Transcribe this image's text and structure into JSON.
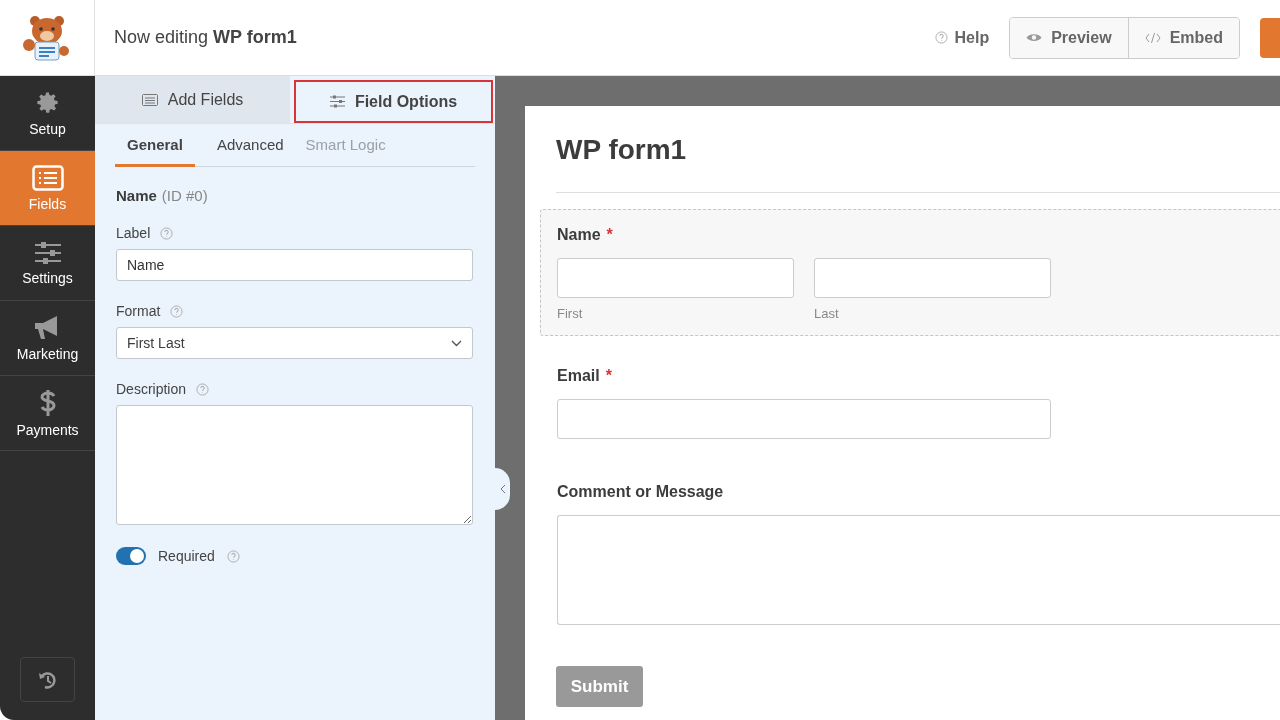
{
  "header": {
    "title": "Now editing **WP form1**",
    "help": "Help",
    "buttons": [
      {
        "label": "Preview",
        "kind": "preview"
      },
      {
        "label": "Embed",
        "kind": "embed"
      }
    ]
  },
  "nav": [
    {
      "label": "Setup",
      "kind": "setup",
      "selected": false
    },
    {
      "label": "Fields",
      "kind": "fields",
      "selected": true
    },
    {
      "label": "Settings",
      "kind": "settings",
      "selected": false
    },
    {
      "label": "Marketing",
      "kind": "marketing",
      "selected": false
    },
    {
      "label": "Payments",
      "kind": "payments",
      "selected": false
    }
  ],
  "panel_tabs": [
    {
      "label": "Add Fields",
      "kind": "add",
      "selected": false,
      "outlined": false
    },
    {
      "label": "Field Options",
      "kind": "options",
      "selected": true,
      "outlined": true
    }
  ],
  "sub_tabs": [
    {
      "label": "General",
      "selected": true,
      "disabled": false
    },
    {
      "label": "Advanced",
      "selected": false,
      "disabled": false
    },
    {
      "label": "Smart Logic",
      "selected": false,
      "disabled": true
    }
  ],
  "field_options": {
    "name": "Name",
    "id": "(ID #0)",
    "label": {
      "label": "Label",
      "value": "Name"
    },
    "format": {
      "label": "Format",
      "value": "First Last"
    },
    "description": {
      "label": "Description"
    },
    "required": {
      "label": "Required",
      "on": true
    }
  },
  "form": {
    "title": "WP form1",
    "fields": [
      {
        "kind": "name",
        "label": "Name",
        "required_mark": "*",
        "selected": true,
        "sublabels": [
          "First",
          "Last"
        ]
      },
      {
        "kind": "email",
        "label": "Email",
        "required_mark": "*",
        "selected": false
      },
      {
        "kind": "textarea",
        "label": "Comment or Message",
        "selected": false
      }
    ],
    "submit": "Submit"
  }
}
